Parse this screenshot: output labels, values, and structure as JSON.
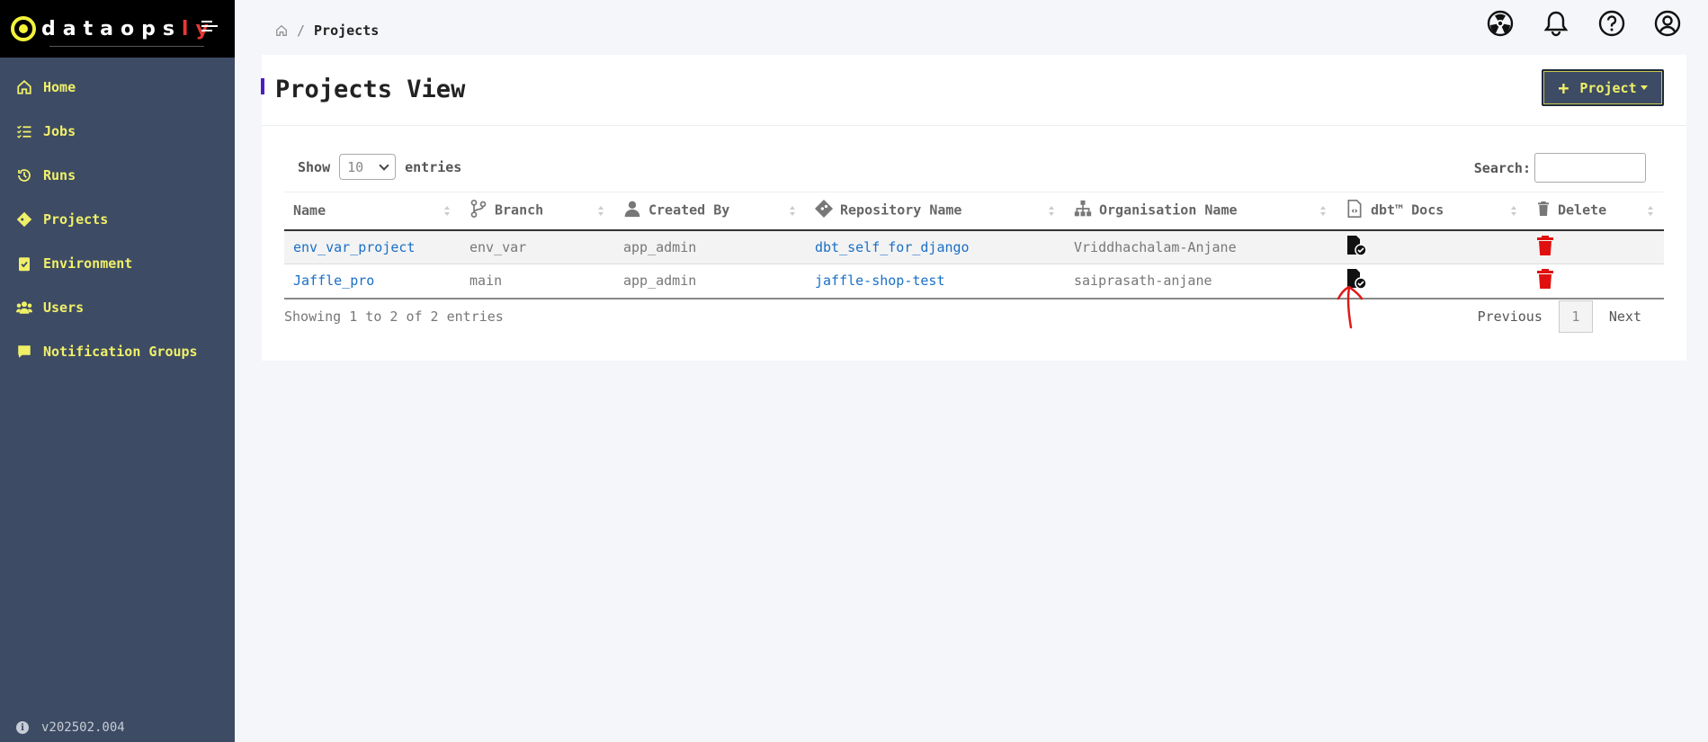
{
  "brand": {
    "prefix": "datao",
    "suffix_white": "ps",
    "suffix_red": "ly"
  },
  "sidebar": {
    "items": [
      {
        "label": "Home",
        "icon": "home-icon"
      },
      {
        "label": "Jobs",
        "icon": "list-check-icon"
      },
      {
        "label": "Runs",
        "icon": "history-icon"
      },
      {
        "label": "Projects",
        "icon": "diamond-icon"
      },
      {
        "label": "Environment",
        "icon": "clipboard-check-icon"
      },
      {
        "label": "Users",
        "icon": "users-icon"
      },
      {
        "label": "Notification Groups",
        "icon": "comment-icon"
      }
    ],
    "version": "v202502.004"
  },
  "breadcrumb": {
    "current": "Projects",
    "separator": "/"
  },
  "header": {
    "icons": [
      "radiation-icon",
      "bell-icon",
      "help-icon",
      "user-circle-icon"
    ]
  },
  "page": {
    "title": "Projects View",
    "add_button": "Project"
  },
  "table_controls": {
    "show_label": "Show",
    "entries_value": "10",
    "entries_label": "entries",
    "search_label": "Search:"
  },
  "table": {
    "columns": [
      "Name",
      "Branch",
      "Created By",
      "Repository Name",
      "Organisation Name",
      "dbt™ Docs",
      "Delete"
    ],
    "rows": [
      {
        "name": "env_var_project",
        "branch": "env_var",
        "created_by": "app_admin",
        "repository": "dbt_self_for_django",
        "organisation": "Vriddhachalam-Anjane"
      },
      {
        "name": "Jaffle_pro",
        "branch": "main",
        "created_by": "app_admin",
        "repository": "jaffle-shop-test",
        "organisation": "saiprasath-anjane"
      }
    ]
  },
  "footer": {
    "showing": "Showing 1 to 2 of 2 entries",
    "previous": "Previous",
    "page": "1",
    "next": "Next"
  },
  "colors": {
    "sidebar": "#3d4b64",
    "accent_yellow": "#f0f068",
    "link": "#1a6fc6",
    "delete": "#e01010",
    "annotation": "#e01818"
  }
}
